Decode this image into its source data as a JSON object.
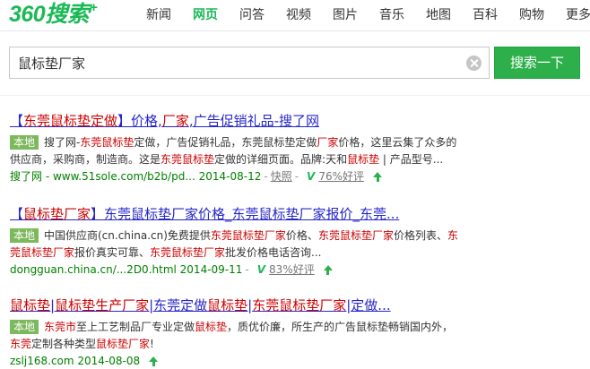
{
  "logo": {
    "text": "360搜索",
    "plus": "+"
  },
  "nav": [
    {
      "label": "新闻",
      "active": false
    },
    {
      "label": "网页",
      "active": true
    },
    {
      "label": "问答",
      "active": false
    },
    {
      "label": "视频",
      "active": false
    },
    {
      "label": "图片",
      "active": false
    },
    {
      "label": "音乐",
      "active": false
    },
    {
      "label": "地图",
      "active": false
    },
    {
      "label": "百科",
      "active": false
    },
    {
      "label": "购物",
      "active": false
    },
    {
      "label": "更多",
      "active": false
    }
  ],
  "search": {
    "query": "鼠标垫厂家",
    "button_label": "搜索一下"
  },
  "colors": {
    "brand": "#19b955",
    "link": "#2626c8",
    "highlight": "#cc0000",
    "badge": "#7cb85c",
    "url": "#008000"
  },
  "results": [
    {
      "title": [
        {
          "t": "【",
          "em": false
        },
        {
          "t": "东莞鼠标垫定做",
          "em": true
        },
        {
          "t": "】价格,",
          "em": false
        },
        {
          "t": "厂家",
          "em": true
        },
        {
          "t": ",广告促销礼品-搜了网",
          "em": false
        }
      ],
      "badge": "本地",
      "lines": [
        [
          {
            "t": "搜了网-",
            "em": false
          },
          {
            "t": "东莞鼠标垫",
            "em": true
          },
          {
            "t": "定做，广告促销礼品，东莞鼠标垫定做",
            "em": false
          },
          {
            "t": "厂家",
            "em": true
          },
          {
            "t": "价格，这里云集了众多的",
            "em": false
          }
        ],
        [
          {
            "t": "供应商，采购商，制造商。这是",
            "em": false
          },
          {
            "t": "东莞鼠标垫",
            "em": true
          },
          {
            "t": "定做的详细页面。品牌:天和",
            "em": false
          },
          {
            "t": "鼠标垫",
            "em": true
          },
          {
            "t": " | 产品型号...",
            "em": false
          }
        ]
      ],
      "url": "搜了网 - www.51sole.com/b2b/pd...",
      "date": "2014-08-12",
      "cache": "快照",
      "rating": "76%好评"
    },
    {
      "title": [
        {
          "t": "【",
          "em": false
        },
        {
          "t": "鼠标垫厂家",
          "em": true
        },
        {
          "t": "】东莞鼠标垫厂家价格_东莞鼠标垫厂家报价_东莞...",
          "em": false
        }
      ],
      "badge": "本地",
      "lines": [
        [
          {
            "t": "中国供应商(cn.china.cn)免费提供",
            "em": false
          },
          {
            "t": "东莞鼠标垫厂家",
            "em": true
          },
          {
            "t": "价格、",
            "em": false
          },
          {
            "t": "东莞鼠标垫厂家",
            "em": true
          },
          {
            "t": "价格列表、",
            "em": false
          },
          {
            "t": "东",
            "em": true
          }
        ],
        [
          {
            "t": "莞鼠标垫厂家",
            "em": true
          },
          {
            "t": "报价真实可靠、",
            "em": false
          },
          {
            "t": "东莞鼠标垫厂家",
            "em": true
          },
          {
            "t": "批发价格电话咨询...",
            "em": false
          }
        ]
      ],
      "url": "dongguan.china.cn/...2D0.html",
      "date": "2014-09-11",
      "rating": "83%好评"
    },
    {
      "title": [
        {
          "t": "鼠标垫",
          "em": true
        },
        {
          "t": "|",
          "em": false
        },
        {
          "t": "鼠标垫生产厂家",
          "em": true
        },
        {
          "t": "|东莞定做",
          "em": false
        },
        {
          "t": "鼠标垫",
          "em": true
        },
        {
          "t": "|",
          "em": false
        },
        {
          "t": "东莞鼠标垫厂家",
          "em": true
        },
        {
          "t": "|定做...",
          "em": false
        }
      ],
      "badge": "本地",
      "lines": [
        [
          {
            "t": "东莞市",
            "em": true
          },
          {
            "t": "至上工艺制品厂专业定做",
            "em": false
          },
          {
            "t": "鼠标垫",
            "em": true
          },
          {
            "t": "，质优价廉，所生产的广告鼠标垫畅销国内外，",
            "em": false
          }
        ],
        [
          {
            "t": "东莞",
            "em": true
          },
          {
            "t": "定制各种类型",
            "em": false
          },
          {
            "t": "鼠标垫厂家",
            "em": true
          },
          {
            "t": "!",
            "em": false
          }
        ]
      ],
      "url": "zslj168.com",
      "date": "2014-08-08"
    }
  ]
}
